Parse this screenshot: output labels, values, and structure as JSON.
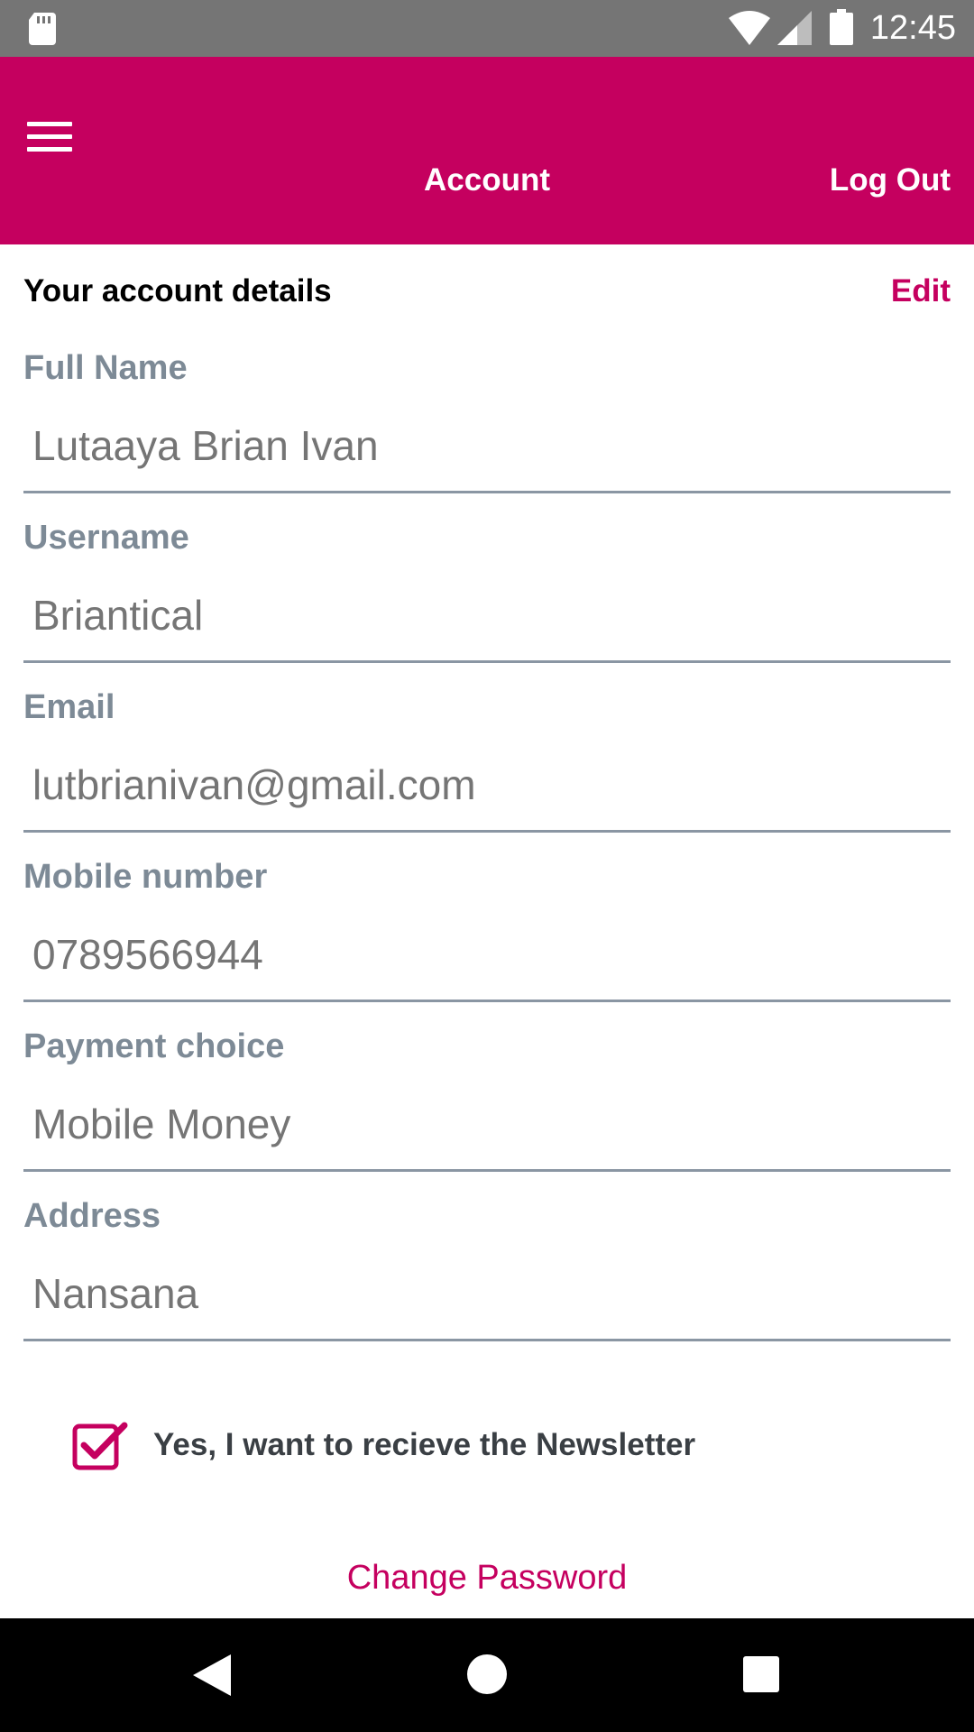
{
  "status_bar": {
    "time": "12:45",
    "icons": [
      "sd-card-icon",
      "wifi-icon",
      "signal-icon",
      "battery-icon"
    ]
  },
  "app_bar": {
    "title": "Account",
    "logout_label": "Log Out",
    "menu_icon": "hamburger-menu-icon"
  },
  "section": {
    "title": "Your account details",
    "edit_label": "Edit"
  },
  "fields": [
    {
      "label": "Full Name",
      "value": "Lutaaya Brian Ivan"
    },
    {
      "label": "Username",
      "value": "Briantical"
    },
    {
      "label": "Email",
      "value": "lutbrianivan@gmail.com"
    },
    {
      "label": "Mobile number",
      "value": "0789566944"
    },
    {
      "label": "Payment choice",
      "value": "Mobile Money"
    },
    {
      "label": "Address",
      "value": "Nansana"
    }
  ],
  "newsletter": {
    "label": "Yes, I want to recieve the Newsletter",
    "checked": true
  },
  "change_password_label": "Change Password",
  "colors": {
    "accent": "#c5005f",
    "status_bar": "#757575",
    "label": "#7d8a96",
    "value": "#757575",
    "divider": "#8a96a3"
  },
  "nav_bar": {
    "icons": [
      "back-icon",
      "home-icon",
      "recents-icon"
    ]
  }
}
